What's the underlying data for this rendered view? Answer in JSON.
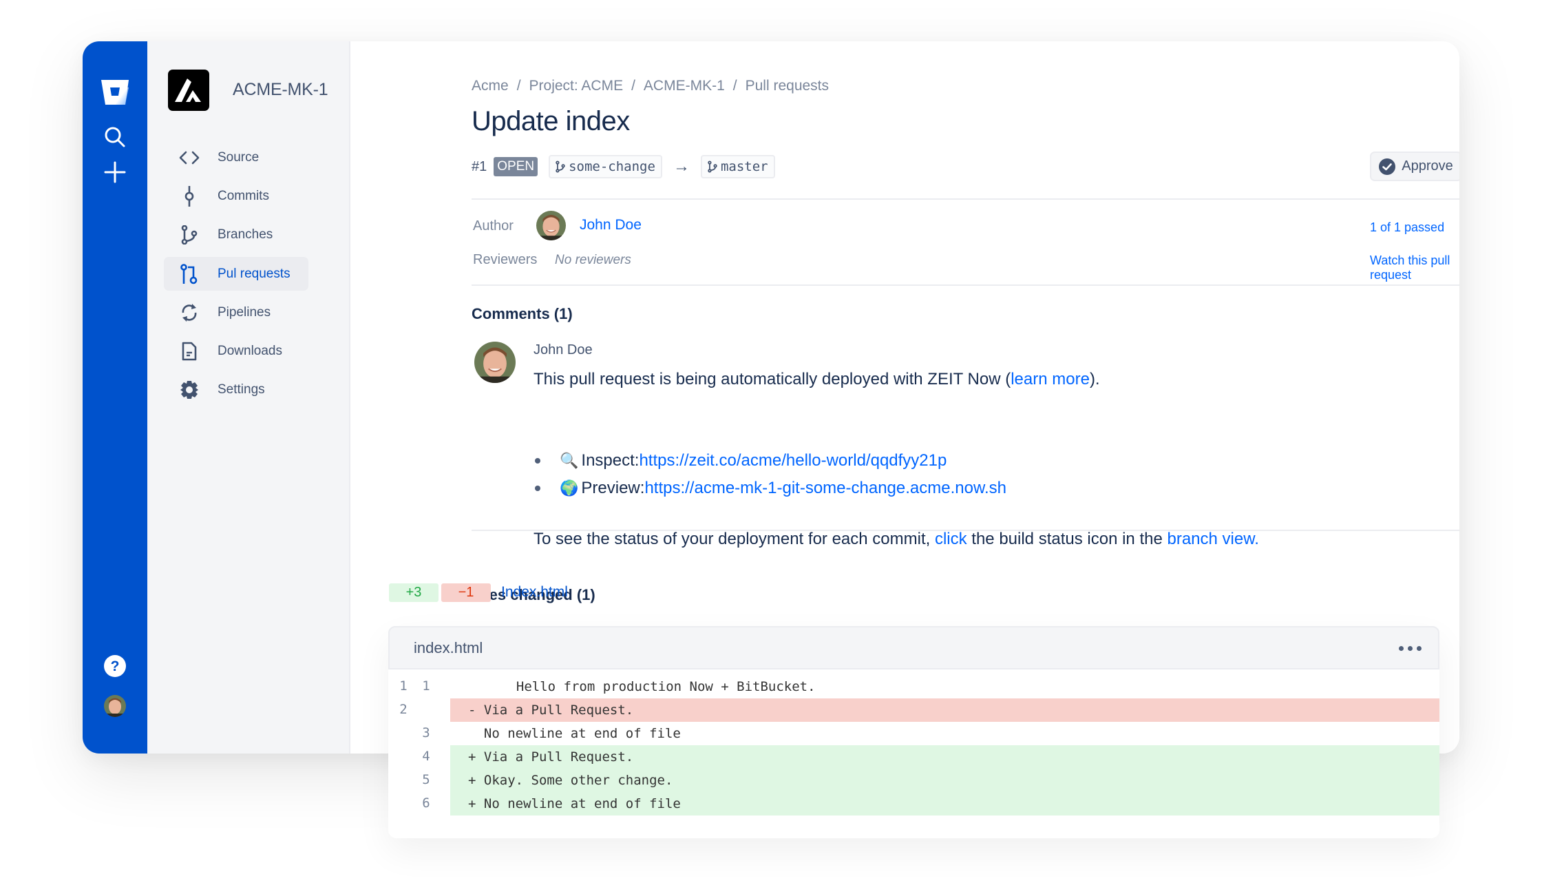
{
  "global_nav": {
    "logo": "bitbucket-logo",
    "icons": [
      "search-icon",
      "plus-icon"
    ],
    "bottom_icons": [
      "help-icon",
      "avatar"
    ]
  },
  "project": {
    "name": "ACME-MK-1",
    "nav_items": [
      {
        "label": "Source",
        "icon": "code-icon",
        "active": false
      },
      {
        "label": "Commits",
        "icon": "commit-icon",
        "active": false
      },
      {
        "label": "Branches",
        "icon": "branch-icon",
        "active": false
      },
      {
        "label": "Pul requests",
        "icon": "pull-request-icon",
        "active": true
      },
      {
        "label": "Pipelines",
        "icon": "pipelines-icon",
        "active": false
      },
      {
        "label": "Downloads",
        "icon": "document-icon",
        "active": false
      },
      {
        "label": "Settings",
        "icon": "gear-icon",
        "active": false
      }
    ]
  },
  "breadcrumb": [
    "Acme",
    "Project: ACME",
    "ACME-MK-1",
    "Pull requests"
  ],
  "breadcrumb_separator": "/",
  "pr": {
    "title": "Update index",
    "number": "#1",
    "state": "OPEN",
    "source_branch": "some-change",
    "arrow": "→",
    "target_branch": "master",
    "approve_label": "Approve",
    "author_label": "Author",
    "author_name": "John Doe",
    "reviewers_label": "Reviewers",
    "reviewers_value": "No reviewers",
    "builds_status": "1 of 1 passed",
    "watch_label": "Watch this pull request"
  },
  "comments": {
    "title": "Comments (1)",
    "items": [
      {
        "author": "John Doe",
        "text_before": "This pull request is being automatically deployed with ZEIT Now (",
        "link_text": "learn more",
        "text_after": ").",
        "bullets": [
          {
            "emoji": "🔍",
            "label": "Inspect: ",
            "url": "https://zeit.co/acme/hello-world/qqdfyy21p"
          },
          {
            "emoji": "🌍",
            "label": "Preview: ",
            "url": "https://acme-mk-1-git-some-change.acme.now.sh"
          }
        ],
        "status_before": "To see the status of your deployment for each commit, ",
        "status_link1": "click",
        "status_middle": " the build status icon in the ",
        "status_link2": "branch view."
      }
    ]
  },
  "files": {
    "title": "Files changed (1)",
    "additions": "+3",
    "deletions": "−1",
    "file_link": "Index.html",
    "diff": {
      "filename": "index.html",
      "lines": [
        {
          "old": "1",
          "new": "1",
          "type": "context",
          "text": "  Hello from production Now + BitBucket."
        },
        {
          "old": "2",
          "new": "",
          "type": "removed",
          "text": "- Via a Pull Request."
        },
        {
          "old": "",
          "new": "3",
          "type": "context",
          "text": "  No newline at end of file"
        },
        {
          "old": "",
          "new": "4",
          "type": "added",
          "text": "+ Via a Pull Request."
        },
        {
          "old": "",
          "new": "5",
          "type": "added",
          "text": "+ Okay. Some other change."
        },
        {
          "old": "",
          "new": "6",
          "type": "added",
          "text": "+ No newline at end of file"
        }
      ]
    }
  },
  "colors": {
    "brand_blue": "#0052cc",
    "link_blue": "#0065ff",
    "added_bg": "#dff7e3",
    "removed_bg": "#f8d0cb",
    "nav_bg": "#f4f5f7"
  }
}
